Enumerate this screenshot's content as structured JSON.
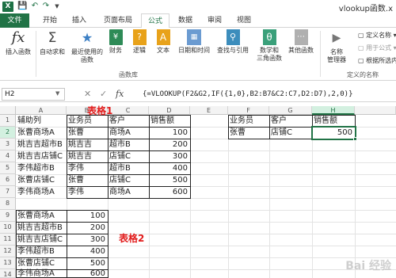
{
  "title_bar": {
    "logo": "X",
    "doc_title": "vlookup函数.x"
  },
  "tabs": [
    "文件",
    "开始",
    "插入",
    "页面布局",
    "公式",
    "数据",
    "审阅",
    "视图"
  ],
  "ribbon": {
    "insert_function": "插入函数",
    "autosum": "自动求和",
    "recent": "最近使用的",
    "recent2": "函数",
    "financial": "财务",
    "logical": "逻辑",
    "text": "文本",
    "datetime": "日期和时间",
    "lookup": "查找与引用",
    "math": "数学和",
    "math2": "三角函数",
    "more": "其他函数",
    "name_manager": "名称",
    "name_manager2": "管理器",
    "define_name": "定义名称",
    "use_in_formula": "用于公式",
    "create_from_sel": "根据所选内容",
    "group_library": "函数库",
    "group_names": "定义的名称"
  },
  "formula_bar": {
    "name_box": "H2",
    "formula": "{=VLOOKUP(F2&G2,IF({1,0},B2:B7&C2:C7,D2:D7),2,0)}"
  },
  "columns": [
    "A",
    "B",
    "C",
    "D",
    "E",
    "F",
    "G",
    "H"
  ],
  "rows": [
    "1",
    "2",
    "3",
    "4",
    "5",
    "6",
    "7",
    "8",
    "9",
    "10",
    "11",
    "12",
    "13",
    "14",
    "15"
  ],
  "table1": {
    "header": [
      "辅助列",
      "业务员",
      "客户",
      "销售额"
    ],
    "rows": [
      [
        "张曹商场A",
        "张曹",
        "商场A",
        "100"
      ],
      [
        "姚吉吉超市B",
        "姚吉吉",
        "超市B",
        "200"
      ],
      [
        "姚吉吉店铺C",
        "姚吉吉",
        "店铺C",
        "300"
      ],
      [
        "李伟超市B",
        "李伟",
        "超市B",
        "400"
      ],
      [
        "张曹店铺C",
        "张曹",
        "店铺C",
        "500"
      ],
      [
        "李伟商场A",
        "李伟",
        "商场A",
        "600"
      ]
    ]
  },
  "table2": {
    "rows": [
      [
        "张曹商场A",
        "100"
      ],
      [
        "姚吉吉超市B",
        "200"
      ],
      [
        "姚吉吉店铺C",
        "300"
      ],
      [
        "李伟超市B",
        "400"
      ],
      [
        "张曹店铺C",
        "500"
      ],
      [
        "李伟商场A",
        "600"
      ]
    ]
  },
  "lookup_table": {
    "header": [
      "业务员",
      "客户",
      "销售额"
    ],
    "row": [
      "张曹",
      "店铺C",
      "500"
    ]
  },
  "annotations": {
    "table1": "表格1",
    "table2": "表格2"
  },
  "watermark": "Bai 经验",
  "colors": {
    "excel_green": "#217346",
    "annotation_red": "#e21b1b"
  }
}
